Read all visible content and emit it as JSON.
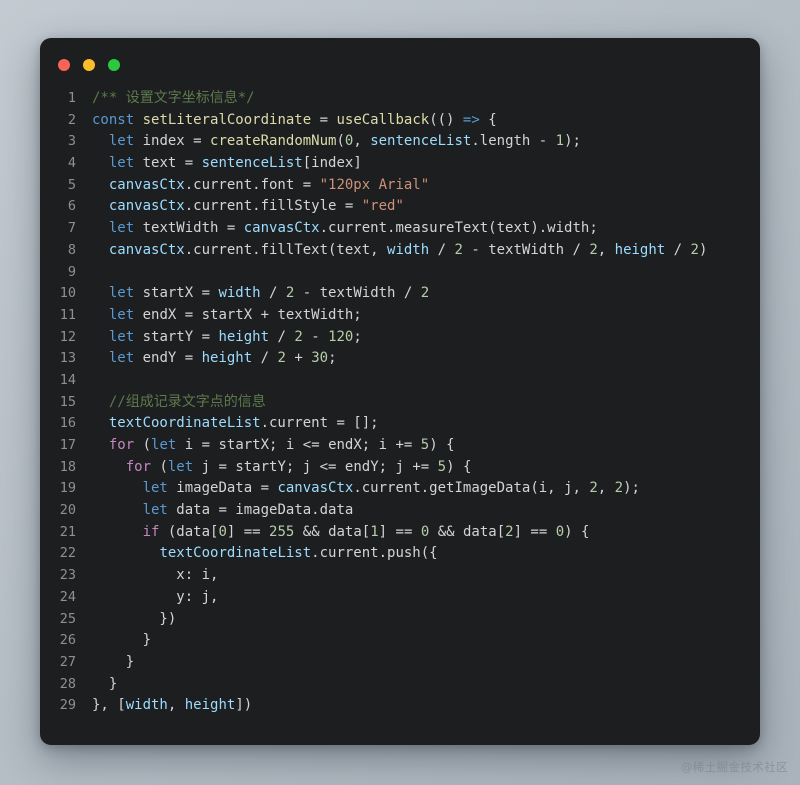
{
  "window": {
    "traffic_lights": [
      {
        "name": "close",
        "color": "#f9635a"
      },
      {
        "name": "minimize",
        "color": "#fcbd2b"
      },
      {
        "name": "maximize",
        "color": "#2bc93f"
      }
    ],
    "background": "#1c1e20",
    "page_background": "#b6bec6"
  },
  "watermark": {
    "text": "@稀土掘金技术社区"
  },
  "editor": {
    "language": "javascript",
    "first_line_number": 1,
    "last_line_number": 29,
    "line_numbers": [
      "1",
      "2",
      "3",
      "4",
      "5",
      "6",
      "7",
      "8",
      "9",
      "10",
      "11",
      "12",
      "13",
      "14",
      "15",
      "16",
      "17",
      "18",
      "19",
      "20",
      "21",
      "22",
      "23",
      "24",
      "25",
      "26",
      "27",
      "28",
      "29"
    ],
    "plain_text": [
      "/** 设置文字坐标信息*/",
      "const setLiteralCoordinate = useCallback(() => {",
      "  let index = createRandomNum(0, sentenceList.length - 1);",
      "  let text = sentenceList[index]",
      "  canvasCtx.current.font = \"120px Arial\"",
      "  canvasCtx.current.fillStyle = \"red\"",
      "  let textWidth = canvasCtx.current.measureText(text).width;",
      "  canvasCtx.current.fillText(text, width / 2 - textWidth / 2, height / 2)",
      "",
      "  let startX = width / 2 - textWidth / 2",
      "  let endX = startX + textWidth;",
      "  let startY = height / 2 - 120;",
      "  let endY = height / 2 + 30;",
      "",
      "  //组成记录文字点的信息",
      "  textCoordinateList.current = [];",
      "  for (let i = startX; i <= endX; i += 5) {",
      "    for (let j = startY; j <= endY; j += 5) {",
      "      let imageData = canvasCtx.current.getImageData(i, j, 2, 2);",
      "      let data = imageData.data",
      "      if (data[0] == 255 && data[1] == 0 && data[2] == 0) {",
      "        textCoordinateList.current.push({",
      "          x: i,",
      "          y: j,",
      "        })",
      "      }",
      "    }",
      "  }",
      "}, [width, height])"
    ],
    "lines": [
      {
        "n": "1",
        "tokens": [
          {
            "t": "/** 设置文字坐标信息*/",
            "c": "t-cmt"
          }
        ]
      },
      {
        "n": "2",
        "tokens": [
          {
            "t": "const",
            "c": "t-kw"
          },
          {
            "t": " ",
            "c": "t-pln"
          },
          {
            "t": "setLiteralCoordinate",
            "c": "t-fn"
          },
          {
            "t": " = ",
            "c": "t-op"
          },
          {
            "t": "useCallback",
            "c": "t-fn"
          },
          {
            "t": "(() ",
            "c": "t-pln"
          },
          {
            "t": "=>",
            "c": "t-kw"
          },
          {
            "t": " {",
            "c": "t-pln"
          }
        ]
      },
      {
        "n": "3",
        "tokens": [
          {
            "t": "  ",
            "c": "t-pln"
          },
          {
            "t": "let",
            "c": "t-kw"
          },
          {
            "t": " index ",
            "c": "t-pln"
          },
          {
            "t": "= ",
            "c": "t-op"
          },
          {
            "t": "createRandomNum",
            "c": "t-fn"
          },
          {
            "t": "(",
            "c": "t-pln"
          },
          {
            "t": "0",
            "c": "t-num"
          },
          {
            "t": ", ",
            "c": "t-pln"
          },
          {
            "t": "sentenceList",
            "c": "t-var"
          },
          {
            "t": ".length ",
            "c": "t-pln"
          },
          {
            "t": "- ",
            "c": "t-op"
          },
          {
            "t": "1",
            "c": "t-num"
          },
          {
            "t": ");",
            "c": "t-pln"
          }
        ]
      },
      {
        "n": "4",
        "tokens": [
          {
            "t": "  ",
            "c": "t-pln"
          },
          {
            "t": "let",
            "c": "t-kw"
          },
          {
            "t": " text ",
            "c": "t-pln"
          },
          {
            "t": "= ",
            "c": "t-op"
          },
          {
            "t": "sentenceList",
            "c": "t-var"
          },
          {
            "t": "[index]",
            "c": "t-pln"
          }
        ]
      },
      {
        "n": "5",
        "tokens": [
          {
            "t": "  ",
            "c": "t-pln"
          },
          {
            "t": "canvasCtx",
            "c": "t-var"
          },
          {
            "t": ".current.font ",
            "c": "t-pln"
          },
          {
            "t": "= ",
            "c": "t-op"
          },
          {
            "t": "\"120px Arial\"",
            "c": "t-str"
          }
        ]
      },
      {
        "n": "6",
        "tokens": [
          {
            "t": "  ",
            "c": "t-pln"
          },
          {
            "t": "canvasCtx",
            "c": "t-var"
          },
          {
            "t": ".current.fillStyle ",
            "c": "t-pln"
          },
          {
            "t": "= ",
            "c": "t-op"
          },
          {
            "t": "\"red\"",
            "c": "t-str"
          }
        ]
      },
      {
        "n": "7",
        "tokens": [
          {
            "t": "  ",
            "c": "t-pln"
          },
          {
            "t": "let",
            "c": "t-kw"
          },
          {
            "t": " textWidth ",
            "c": "t-pln"
          },
          {
            "t": "= ",
            "c": "t-op"
          },
          {
            "t": "canvasCtx",
            "c": "t-var"
          },
          {
            "t": ".current.",
            "c": "t-pln"
          },
          {
            "t": "measureText",
            "c": "t-pln"
          },
          {
            "t": "(text).width;",
            "c": "t-pln"
          }
        ]
      },
      {
        "n": "8",
        "tokens": [
          {
            "t": "  ",
            "c": "t-pln"
          },
          {
            "t": "canvasCtx",
            "c": "t-var"
          },
          {
            "t": ".current.fillText(text, ",
            "c": "t-pln"
          },
          {
            "t": "width",
            "c": "t-var"
          },
          {
            "t": " / ",
            "c": "t-op"
          },
          {
            "t": "2",
            "c": "t-num"
          },
          {
            "t": " - textWidth / ",
            "c": "t-pln"
          },
          {
            "t": "2",
            "c": "t-num"
          },
          {
            "t": ", ",
            "c": "t-pln"
          },
          {
            "t": "height",
            "c": "t-var"
          },
          {
            "t": " / ",
            "c": "t-op"
          },
          {
            "t": "2",
            "c": "t-num"
          },
          {
            "t": ")",
            "c": "t-pln"
          }
        ]
      },
      {
        "n": "9",
        "tokens": [
          {
            "t": "",
            "c": "t-pln"
          }
        ]
      },
      {
        "n": "10",
        "tokens": [
          {
            "t": "  ",
            "c": "t-pln"
          },
          {
            "t": "let",
            "c": "t-kw"
          },
          {
            "t": " startX ",
            "c": "t-pln"
          },
          {
            "t": "= ",
            "c": "t-op"
          },
          {
            "t": "width",
            "c": "t-var"
          },
          {
            "t": " / ",
            "c": "t-op"
          },
          {
            "t": "2",
            "c": "t-num"
          },
          {
            "t": " - textWidth / ",
            "c": "t-pln"
          },
          {
            "t": "2",
            "c": "t-num"
          }
        ]
      },
      {
        "n": "11",
        "tokens": [
          {
            "t": "  ",
            "c": "t-pln"
          },
          {
            "t": "let",
            "c": "t-kw"
          },
          {
            "t": " endX ",
            "c": "t-pln"
          },
          {
            "t": "= ",
            "c": "t-op"
          },
          {
            "t": "startX + textWidth;",
            "c": "t-pln"
          }
        ]
      },
      {
        "n": "12",
        "tokens": [
          {
            "t": "  ",
            "c": "t-pln"
          },
          {
            "t": "let",
            "c": "t-kw"
          },
          {
            "t": " startY ",
            "c": "t-pln"
          },
          {
            "t": "= ",
            "c": "t-op"
          },
          {
            "t": "height",
            "c": "t-var"
          },
          {
            "t": " / ",
            "c": "t-op"
          },
          {
            "t": "2",
            "c": "t-num"
          },
          {
            "t": " - ",
            "c": "t-pln"
          },
          {
            "t": "120",
            "c": "t-num"
          },
          {
            "t": ";",
            "c": "t-pln"
          }
        ]
      },
      {
        "n": "13",
        "tokens": [
          {
            "t": "  ",
            "c": "t-pln"
          },
          {
            "t": "let",
            "c": "t-kw"
          },
          {
            "t": " endY ",
            "c": "t-pln"
          },
          {
            "t": "= ",
            "c": "t-op"
          },
          {
            "t": "height",
            "c": "t-var"
          },
          {
            "t": " / ",
            "c": "t-op"
          },
          {
            "t": "2",
            "c": "t-num"
          },
          {
            "t": " + ",
            "c": "t-pln"
          },
          {
            "t": "30",
            "c": "t-num"
          },
          {
            "t": ";",
            "c": "t-pln"
          }
        ]
      },
      {
        "n": "14",
        "tokens": [
          {
            "t": "",
            "c": "t-pln"
          }
        ]
      },
      {
        "n": "15",
        "tokens": [
          {
            "t": "  ",
            "c": "t-pln"
          },
          {
            "t": "//组成记录文字点的信息",
            "c": "t-cmt"
          }
        ]
      },
      {
        "n": "16",
        "tokens": [
          {
            "t": "  ",
            "c": "t-pln"
          },
          {
            "t": "textCoordinateList",
            "c": "t-var"
          },
          {
            "t": ".current ",
            "c": "t-pln"
          },
          {
            "t": "= ",
            "c": "t-op"
          },
          {
            "t": "[];",
            "c": "t-pln"
          }
        ]
      },
      {
        "n": "17",
        "tokens": [
          {
            "t": "  ",
            "c": "t-pln"
          },
          {
            "t": "for",
            "c": "t-ctl"
          },
          {
            "t": " (",
            "c": "t-pln"
          },
          {
            "t": "let",
            "c": "t-kw"
          },
          {
            "t": " i ",
            "c": "t-pln"
          },
          {
            "t": "= ",
            "c": "t-op"
          },
          {
            "t": "startX; i ",
            "c": "t-pln"
          },
          {
            "t": "<= ",
            "c": "t-op"
          },
          {
            "t": "endX; i ",
            "c": "t-pln"
          },
          {
            "t": "+= ",
            "c": "t-op"
          },
          {
            "t": "5",
            "c": "t-num"
          },
          {
            "t": ") {",
            "c": "t-pln"
          }
        ]
      },
      {
        "n": "18",
        "tokens": [
          {
            "t": "    ",
            "c": "t-pln"
          },
          {
            "t": "for",
            "c": "t-ctl"
          },
          {
            "t": " (",
            "c": "t-pln"
          },
          {
            "t": "let",
            "c": "t-kw"
          },
          {
            "t": " j ",
            "c": "t-pln"
          },
          {
            "t": "= ",
            "c": "t-op"
          },
          {
            "t": "startY; j ",
            "c": "t-pln"
          },
          {
            "t": "<= ",
            "c": "t-op"
          },
          {
            "t": "endY; j ",
            "c": "t-pln"
          },
          {
            "t": "+= ",
            "c": "t-op"
          },
          {
            "t": "5",
            "c": "t-num"
          },
          {
            "t": ") {",
            "c": "t-pln"
          }
        ]
      },
      {
        "n": "19",
        "tokens": [
          {
            "t": "      ",
            "c": "t-pln"
          },
          {
            "t": "let",
            "c": "t-kw"
          },
          {
            "t": " imageData ",
            "c": "t-pln"
          },
          {
            "t": "= ",
            "c": "t-op"
          },
          {
            "t": "canvasCtx",
            "c": "t-var"
          },
          {
            "t": ".current.getImageData(i, j, ",
            "c": "t-pln"
          },
          {
            "t": "2",
            "c": "t-num"
          },
          {
            "t": ", ",
            "c": "t-pln"
          },
          {
            "t": "2",
            "c": "t-num"
          },
          {
            "t": ");",
            "c": "t-pln"
          }
        ]
      },
      {
        "n": "20",
        "tokens": [
          {
            "t": "      ",
            "c": "t-pln"
          },
          {
            "t": "let",
            "c": "t-kw"
          },
          {
            "t": " data ",
            "c": "t-pln"
          },
          {
            "t": "= ",
            "c": "t-op"
          },
          {
            "t": "imageData.data",
            "c": "t-pln"
          }
        ]
      },
      {
        "n": "21",
        "tokens": [
          {
            "t": "      ",
            "c": "t-pln"
          },
          {
            "t": "if",
            "c": "t-ctl"
          },
          {
            "t": " (data[",
            "c": "t-pln"
          },
          {
            "t": "0",
            "c": "t-num"
          },
          {
            "t": "] ",
            "c": "t-pln"
          },
          {
            "t": "== ",
            "c": "t-op"
          },
          {
            "t": "255",
            "c": "t-num"
          },
          {
            "t": " ",
            "c": "t-pln"
          },
          {
            "t": "&&",
            "c": "t-op"
          },
          {
            "t": " data[",
            "c": "t-pln"
          },
          {
            "t": "1",
            "c": "t-num"
          },
          {
            "t": "] ",
            "c": "t-pln"
          },
          {
            "t": "== ",
            "c": "t-op"
          },
          {
            "t": "0",
            "c": "t-num"
          },
          {
            "t": " ",
            "c": "t-pln"
          },
          {
            "t": "&&",
            "c": "t-op"
          },
          {
            "t": " data[",
            "c": "t-pln"
          },
          {
            "t": "2",
            "c": "t-num"
          },
          {
            "t": "] ",
            "c": "t-pln"
          },
          {
            "t": "== ",
            "c": "t-op"
          },
          {
            "t": "0",
            "c": "t-num"
          },
          {
            "t": ") {",
            "c": "t-pln"
          }
        ]
      },
      {
        "n": "22",
        "tokens": [
          {
            "t": "        ",
            "c": "t-pln"
          },
          {
            "t": "textCoordinateList",
            "c": "t-var"
          },
          {
            "t": ".current.push({",
            "c": "t-pln"
          }
        ]
      },
      {
        "n": "23",
        "tokens": [
          {
            "t": "          x: i,",
            "c": "t-pln"
          }
        ]
      },
      {
        "n": "24",
        "tokens": [
          {
            "t": "          y: j,",
            "c": "t-pln"
          }
        ]
      },
      {
        "n": "25",
        "tokens": [
          {
            "t": "        })",
            "c": "t-pln"
          }
        ]
      },
      {
        "n": "26",
        "tokens": [
          {
            "t": "      }",
            "c": "t-pln"
          }
        ]
      },
      {
        "n": "27",
        "tokens": [
          {
            "t": "    }",
            "c": "t-pln"
          }
        ]
      },
      {
        "n": "28",
        "tokens": [
          {
            "t": "  }",
            "c": "t-pln"
          }
        ]
      },
      {
        "n": "29",
        "tokens": [
          {
            "t": "}, [",
            "c": "t-pln"
          },
          {
            "t": "width",
            "c": "t-var"
          },
          {
            "t": ", ",
            "c": "t-pln"
          },
          {
            "t": "height",
            "c": "t-var"
          },
          {
            "t": "])",
            "c": "t-pln"
          }
        ]
      }
    ]
  }
}
